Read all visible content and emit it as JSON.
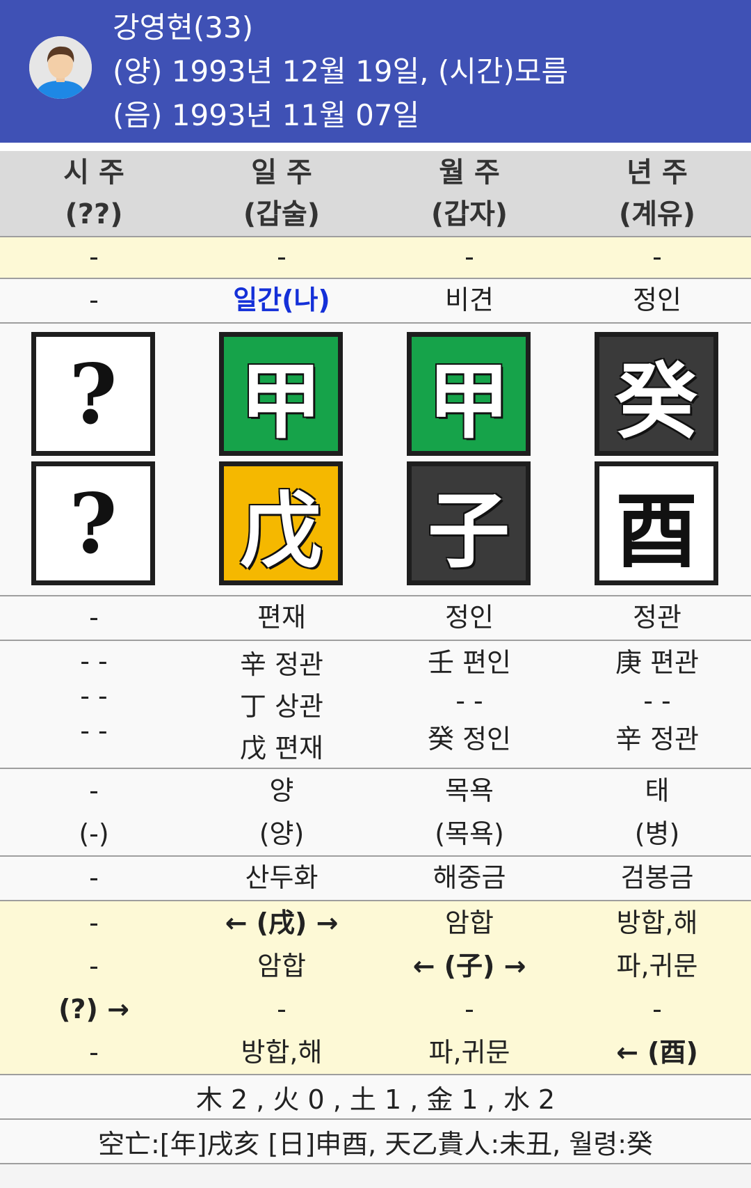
{
  "header": {
    "name_age": "강영현(33)",
    "solar": "(양) 1993년 12월 19일, (시간)모름",
    "lunar": "(음) 1993년 11월 07일"
  },
  "columns": [
    {
      "title": "시 주",
      "sub": "(??)"
    },
    {
      "title": "일 주",
      "sub": "(갑술)"
    },
    {
      "title": "월 주",
      "sub": "(갑자)"
    },
    {
      "title": "년 주",
      "sub": "(계유)"
    }
  ],
  "row_dash": [
    "-",
    "-",
    "-",
    "-"
  ],
  "row_tengod_top": [
    "-",
    "일간(나)",
    "비견",
    "정인"
  ],
  "stems": [
    {
      "char": "?",
      "bg": "#ffffff",
      "fg": "#111111"
    },
    {
      "char": "甲",
      "bg": "#16a34a",
      "fg": "#ffffff"
    },
    {
      "char": "甲",
      "bg": "#16a34a",
      "fg": "#ffffff"
    },
    {
      "char": "癸",
      "bg": "#3a3a3a",
      "fg": "#ffffff"
    }
  ],
  "branches": [
    {
      "char": "?",
      "bg": "#ffffff",
      "fg": "#111111"
    },
    {
      "char": "戊",
      "bg": "#f5b800",
      "fg": "#ffffff"
    },
    {
      "char": "子",
      "bg": "#3a3a3a",
      "fg": "#ffffff"
    },
    {
      "char": "酉",
      "bg": "#ffffff",
      "fg": "#111111"
    }
  ],
  "row_tengod_bottom": [
    "-",
    "편재",
    "정인",
    "정관"
  ],
  "hidden_stems": [
    [
      "- -",
      "- -",
      "- -"
    ],
    [
      "辛 정관",
      "丁 상관",
      "戊 편재"
    ],
    [
      "壬 편인",
      "- -",
      "癸 정인"
    ],
    [
      "庚 편관",
      "- -",
      "辛 정관"
    ]
  ],
  "twelve_stages": [
    [
      "-",
      "(-)"
    ],
    [
      "양",
      "(양)"
    ],
    [
      "목욕",
      "(목욕)"
    ],
    [
      "태",
      "(병)"
    ]
  ],
  "napeum": [
    "-",
    "산두화",
    "해중금",
    "검봉금"
  ],
  "relations": [
    [
      "-",
      "-",
      "(?) →",
      "-"
    ],
    [
      "← (戌) →",
      "암합",
      "-",
      "방합,해"
    ],
    [
      "암합",
      "← (子) →",
      "-",
      "파,귀문"
    ],
    [
      "방합,해",
      "파,귀문",
      "-",
      "← (酉)"
    ]
  ],
  "elements_summary": "木 2 , 火 0 , 土 1 , 金 1 , 水 2",
  "extra_info": "空亡:[年]戌亥 [日]申酉, 天乙貴人:未丑, 월령:癸"
}
